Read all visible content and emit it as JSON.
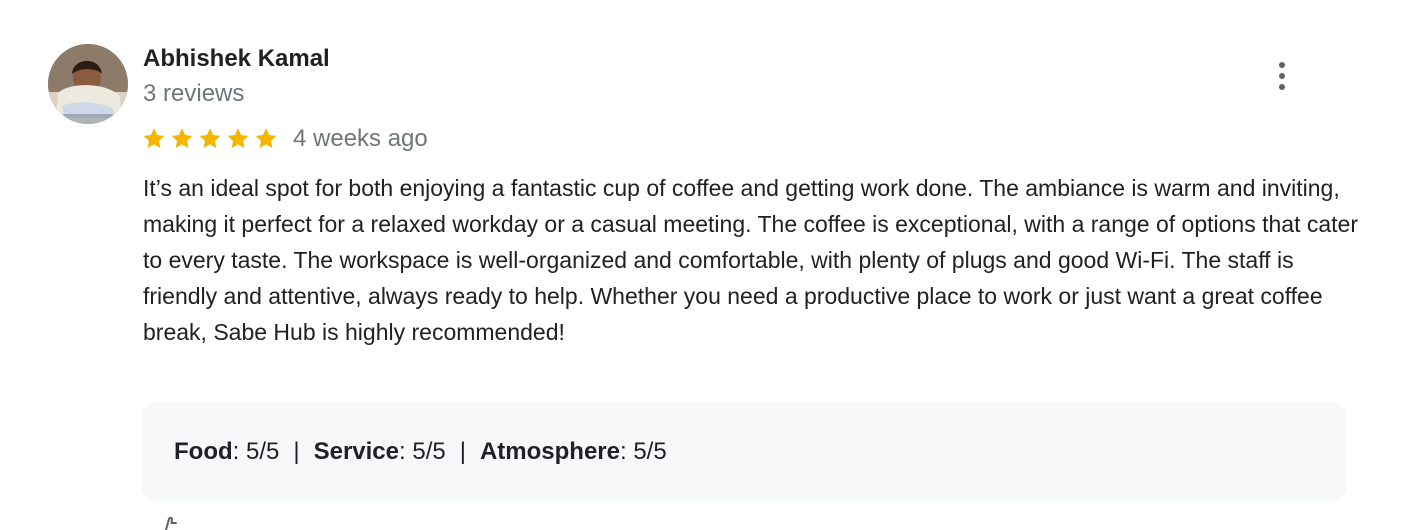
{
  "reviewer": {
    "name": "Abhishek Kamal",
    "review_count": "3 reviews",
    "avatar_icon": "user-photo-avatar"
  },
  "menu": {
    "icon": "more-vertical-icon"
  },
  "rating": {
    "stars": 5,
    "max_stars": 5,
    "star_color": "#f4b400",
    "time": "4 weeks ago"
  },
  "review": {
    "text": "It’s an ideal spot for both enjoying a fantastic cup of coffee and getting work done. The ambiance is warm and inviting, making it perfect for a relaxed workday or a casual meeting. The coffee is exceptional, with a range of options that cater to every taste. The workspace is well-organized and comfortable, with plenty of plugs and good Wi-Fi. The staff is friendly and attentive, always ready to help. Whether you need a productive place to work or just want a great coffee break, Sabe Hub is highly recommended!"
  },
  "attributes": {
    "items": [
      {
        "label": "Food",
        "separator": ": ",
        "value": "5/5"
      },
      {
        "label": "Service",
        "separator": ": ",
        "value": "5/5"
      },
      {
        "label": "Atmosphere",
        "separator": ": ",
        "value": "5/5"
      }
    ],
    "divider": "|",
    "background": "#f7f8fa"
  },
  "footer": {
    "icon": "like-icon"
  }
}
